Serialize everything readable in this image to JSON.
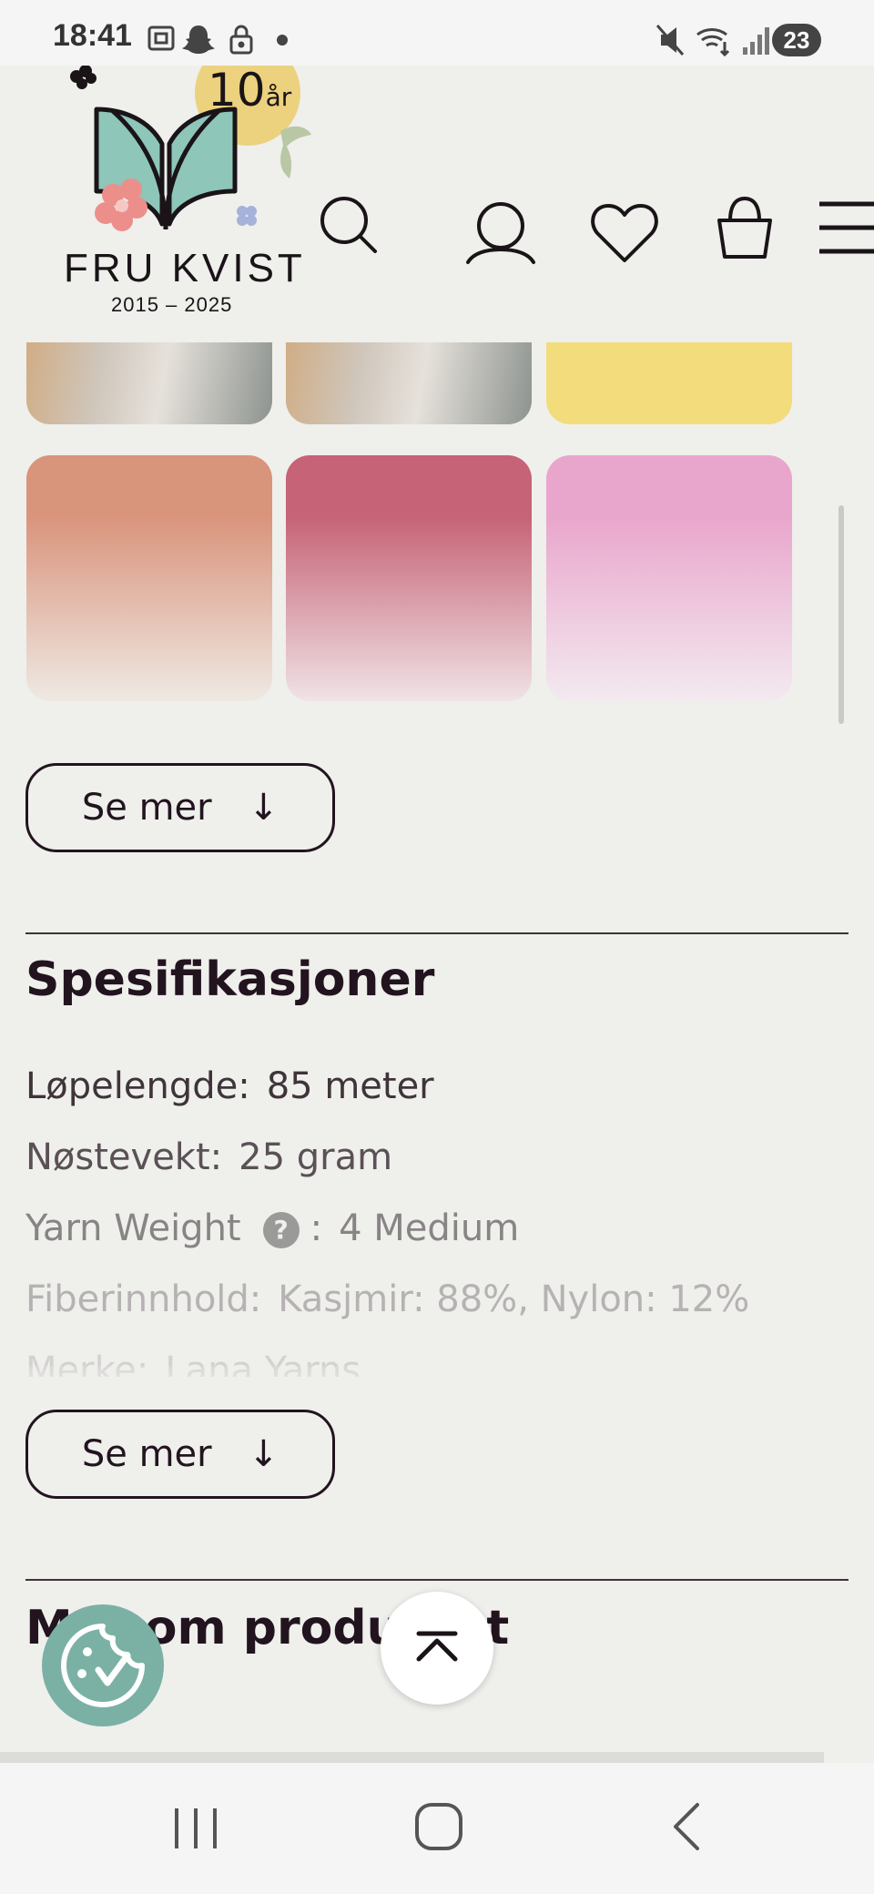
{
  "status_bar": {
    "time": "18:41",
    "notifications_badge": "23",
    "icons_left": [
      "screenshot-icon",
      "snapchat-icon",
      "lock-icon",
      "dot-icon"
    ],
    "icons_right": [
      "mute-icon",
      "wifi-icon",
      "signal-icon"
    ]
  },
  "header": {
    "logo_anniversary": "10",
    "logo_anniversary_suffix": "år",
    "logo_name": "FRU KVIST",
    "logo_years": "2015 – 2025",
    "icons": [
      "search-icon",
      "account-icon",
      "wishlist-heart-icon",
      "shopping-bag-icon",
      "menu-icon"
    ]
  },
  "swatches": {
    "top_row_colors": [
      "#b7a898",
      "#b7a898",
      "#f3dc7c"
    ],
    "second_row": [
      {
        "color_top": "#d9947c",
        "color_bottom": "#efe9e3"
      },
      {
        "color_top": "#c66376",
        "color_bottom": "#f0e3e6"
      },
      {
        "color_top": "#e9a6cc",
        "color_bottom": "#f3eaf0"
      }
    ]
  },
  "see_more_1": {
    "label": "Se mer",
    "arrow": "↓"
  },
  "specifications": {
    "title": "Spesifikasjoner",
    "rows": [
      {
        "label": "Løpelengde:",
        "value": "85 meter"
      },
      {
        "label": "Nøstevekt:",
        "value": "25 gram"
      },
      {
        "label": "Yarn Weight",
        "help": "?",
        "sep": ":",
        "value": "4 Medium"
      },
      {
        "label": "Fiberinnhold:",
        "value": "Kasjmir: 88%, Nylon: 12%"
      },
      {
        "label": "Merke:",
        "value": "Lana Yarns"
      }
    ]
  },
  "see_more_2": {
    "label": "Se mer",
    "arrow": "↓"
  },
  "more_about": {
    "title": "Mer om produktet"
  },
  "colors": {
    "background": "#efefec",
    "text": "#22141f",
    "cookie_button": "#7ab1a4",
    "logo_badge": "#ecd27e",
    "book_teal": "#8ec6b9"
  }
}
